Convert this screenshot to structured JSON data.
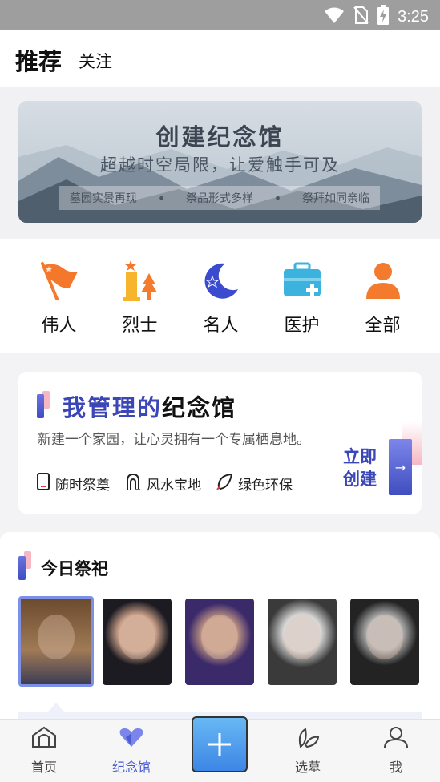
{
  "status": {
    "time": "3:25"
  },
  "tabs": {
    "recommend": "推荐",
    "follow": "关注"
  },
  "banner": {
    "title": "创建纪念馆",
    "subtitle": "超越时空局限，让爱触手可及",
    "points": [
      "墓园实景再现",
      "祭品形式多样",
      "祭拜如同亲临"
    ]
  },
  "categories": [
    {
      "label": "伟人",
      "icon": "red-flag-icon"
    },
    {
      "label": "烈士",
      "icon": "martyr-monument-icon"
    },
    {
      "label": "名人",
      "icon": "moon-star-icon"
    },
    {
      "label": "医护",
      "icon": "medical-kit-icon"
    },
    {
      "label": "全部",
      "icon": "person-icon"
    }
  ],
  "manage": {
    "title_part1": "我管理的",
    "title_part2": "纪念馆",
    "desc": "新建一个家园，让心灵拥有一个专属栖息地。",
    "features": [
      "随时祭奠",
      "风水宝地",
      "绿色环保"
    ],
    "create_label": "立即创建",
    "create_arrow": "→"
  },
  "today": {
    "title": "今日祭祀",
    "portraits": [
      "portrait-1",
      "portrait-2",
      "portrait-3",
      "portrait-4",
      "portrait-5"
    ]
  },
  "nav": {
    "home": "首页",
    "memorial": "纪念馆",
    "add": "+",
    "select_tomb": "选墓",
    "me": "我"
  },
  "colors": {
    "accent": "#4b5bd2",
    "orange": "#f47a2e"
  }
}
